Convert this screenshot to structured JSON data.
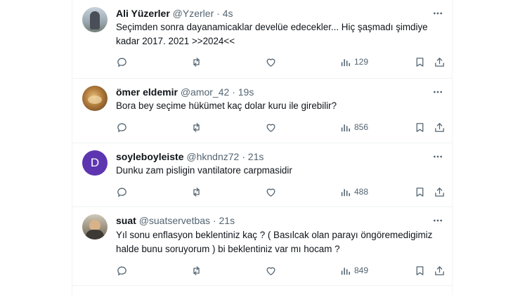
{
  "colors": {
    "text_primary": "#0f1419",
    "text_secondary": "#536471",
    "divider": "#eff3f4",
    "avatar_d_bg": "#5e35b1"
  },
  "tweets": [
    {
      "name": "Ali Yüzerler",
      "handle": "@Yzerler",
      "dot": "·",
      "time": "4s",
      "text": "Seçimden sonra dayanamicaklar develüe edecekler... Hiç şaşmadı şimdiye\nkadar 2017. 2021 >>2024<<",
      "views": "129",
      "avatar_icon": "person-photo-icon"
    },
    {
      "name": "ömer eldemir",
      "handle": "@amor_42",
      "dot": "·",
      "time": "19s",
      "text": "Bora bey seçime hükümet kaç dolar kuru ile girebilir?",
      "views": "856",
      "avatar_icon": "photo-icon"
    },
    {
      "name": "soyleboyleiste",
      "handle": "@hkndnz72",
      "dot": "·",
      "time": "21s",
      "text": "Dunku zam pisligin vantilatore carpmasidir",
      "views": "488",
      "avatar_letter": "D"
    },
    {
      "name": "suat",
      "handle": "@suatservetbas",
      "dot": "·",
      "time": "21s",
      "text": "Yıl sonu enflasyon beklentiniz kaç ? ( Basılcak olan parayı öngöremedigimiz\nhalde bunu soruyorum ) bi beklentiniz var mı hocam ?",
      "views": "849",
      "avatar_icon": "person-photo-icon"
    }
  ],
  "icons": {
    "more": "more-horizontal-icon",
    "reply": "reply-icon",
    "retweet": "retweet-icon",
    "like": "heart-icon",
    "views": "views-chart-icon",
    "bookmark": "bookmark-icon",
    "share": "share-icon"
  }
}
